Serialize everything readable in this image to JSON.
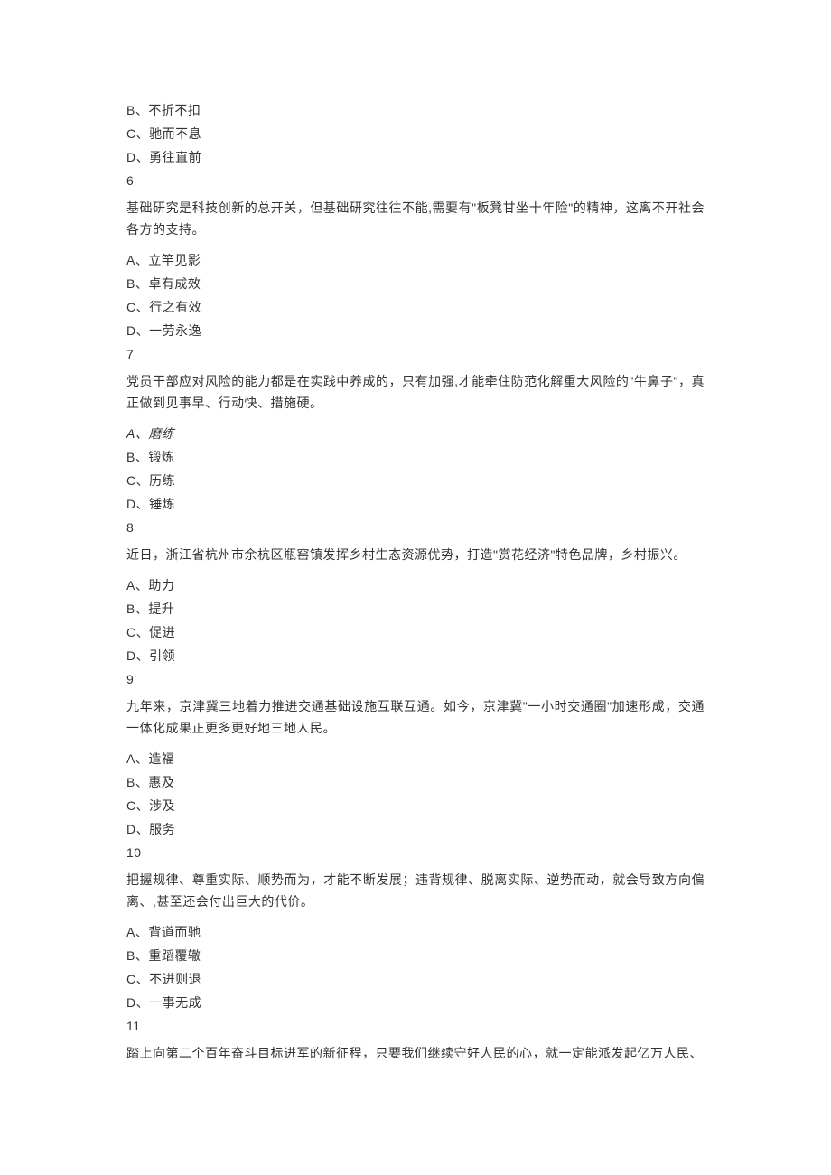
{
  "top_options": {
    "b": "B、不折不扣",
    "c": "C、驰而不息",
    "d": "D、勇往直前"
  },
  "q6": {
    "num": "6",
    "stem": "基础研究是科技创新的总开关，但基础研究往往不能,需要有\"板凳甘坐十年险\"的精神，这离不开社会各方的支持。",
    "a": "A、立竿见影",
    "b": "B、卓有成效",
    "c": "C、行之有效",
    "d": "D、一劳永逸"
  },
  "q7": {
    "num": "7",
    "stem": "党员干部应对风险的能力都是在实践中养成的，只有加强,才能牵住防范化解重大风险的\"牛鼻子\"，真正做到见事早、行动快、措施硬。",
    "a": "A、磨练",
    "b": "B、锻炼",
    "c": "C、历练",
    "d": "D、锤炼"
  },
  "q8": {
    "num": "8",
    "stem": "近日，浙江省杭州市余杭区瓶窑镇发挥乡村生态资源优势，打造\"赏花经济\"特色品牌，乡村振兴。",
    "a": "A、助力",
    "b": "B、提升",
    "c": "C、促进",
    "d": "D、引领"
  },
  "q9": {
    "num": "9",
    "stem": "九年来，京津冀三地着力推进交通基础设施互联互通。如今，京津冀\"一小时交通圈\"加速形成，交通一体化成果正更多更好地三地人民。",
    "a": "A、造福",
    "b": "B、惠及",
    "c": "C、涉及",
    "d": "D、服务"
  },
  "q10": {
    "num": "10",
    "stem": "把握规律、尊重实际、顺势而为，才能不断发展；违背规律、脱离实际、逆势而动，就会导致方向偏离、,甚至还会付出巨大的代价。",
    "a": "A、背道而驰",
    "b": "B、重蹈覆辙",
    "c": "C、不进则退",
    "d": "D、一事无成"
  },
  "q11": {
    "num": "11",
    "stem": "踏上向第二个百年奋斗目标进军的新征程，只要我们继续守好人民的心，就一定能派发起亿万人民、"
  }
}
